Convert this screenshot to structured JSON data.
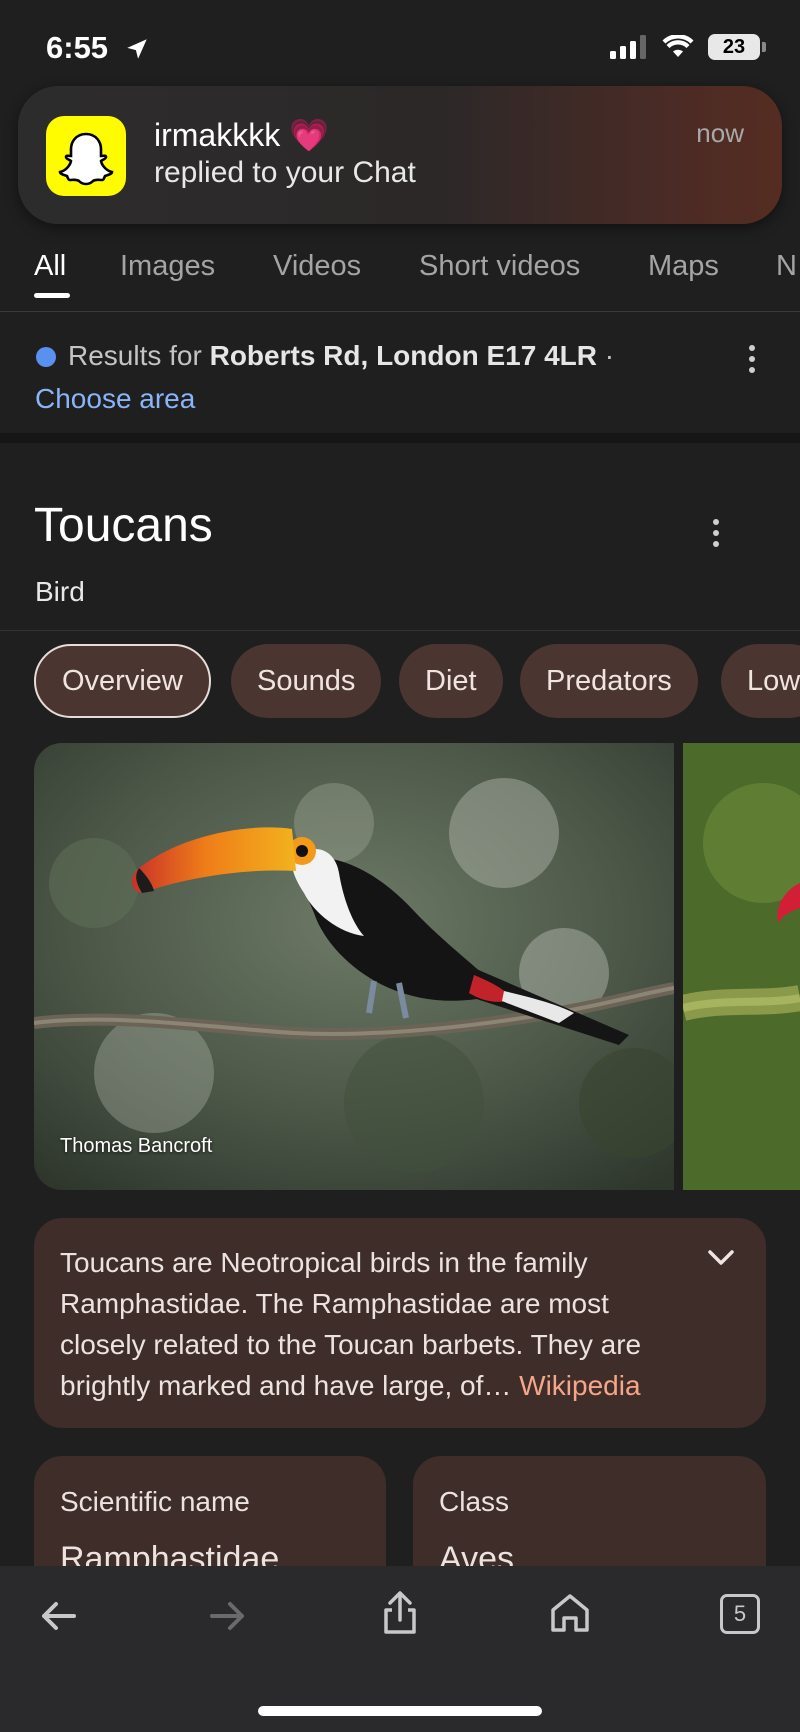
{
  "status_bar": {
    "time": "6:55",
    "battery": "23"
  },
  "notification": {
    "app_icon": "snapchat-ghost-icon",
    "title": "irmakkkk 💗",
    "body": "replied to your Chat",
    "time": "now"
  },
  "search_tabs": {
    "items": [
      "All",
      "Images",
      "Videos",
      "Short videos",
      "Maps",
      "N"
    ],
    "active": "All"
  },
  "location": {
    "prefix": "Results for ",
    "place": "Roberts Rd, London E17 4LR",
    "separator": " ·",
    "choose_area": "Choose area"
  },
  "knowledge_panel": {
    "title": "Toucans",
    "subtitle": "Bird",
    "chips": [
      "Overview",
      "Sounds",
      "Diet",
      "Predators",
      "Low"
    ],
    "active_chip": "Overview",
    "image_credit": "Thomas Bancroft",
    "description": "Toucans are Neotropical birds in the family Ramphastidae. The Ramphastidae are most closely related to the Toucan barbets. They are brightly marked and have large, of…",
    "description_link": "Wikipedia",
    "facts": [
      {
        "label": "Scientific name",
        "value": "Ramphastidae"
      },
      {
        "label": "Class",
        "value": "Aves"
      }
    ]
  },
  "browser_toolbar": {
    "tab_count": "5"
  },
  "colors": {
    "background": "#1f1f1f",
    "chip_bg": "#4a3530",
    "card_bg": "#3e2d28",
    "link_blue": "#8ab4f8",
    "link_orange": "#f4a58a",
    "snapchat_yellow": "#fffc00"
  }
}
